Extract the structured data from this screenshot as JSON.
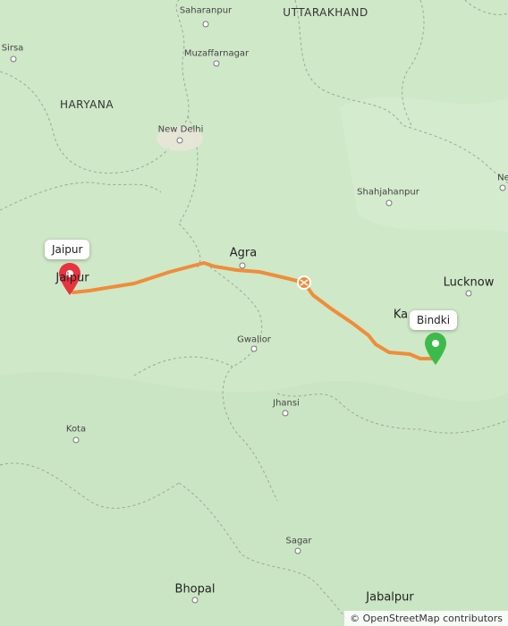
{
  "colors": {
    "land": "#cfe8c8",
    "route": "#ef8d3a",
    "border": "#9aa89a",
    "pin_start": "#e8343f",
    "pin_end": "#3dbb4a"
  },
  "states": {
    "uttarakhand": "UTTARAKHAND",
    "haryana": "HARYANA"
  },
  "cities": {
    "saharanpur": "Saharanpur",
    "muzaffarnagar": "Muzaffarnagar",
    "new_delhi": "New Delhi",
    "sirsa": "Sirsa",
    "shahjahanpur": "Shahjahanpur",
    "agra": "Agra",
    "lucknow": "Lucknow",
    "gwalior": "Gwalior",
    "jhansi": "Jhansi",
    "kota": "Kota",
    "sagar": "Sagar",
    "bhopal": "Bhopal",
    "jabalpur": "Jabalpur",
    "jaipur_map": "Jaipur",
    "kanpur_partial": "Ka",
    "nepal_partial": "Ne"
  },
  "route": {
    "start_label": "Jaipur",
    "end_label": "Bindki"
  },
  "icons": {
    "start_pin": "map-pin-red",
    "end_pin": "map-pin-green",
    "toll": "toll-icon"
  },
  "attribution": "© OpenStreetMap contributors"
}
